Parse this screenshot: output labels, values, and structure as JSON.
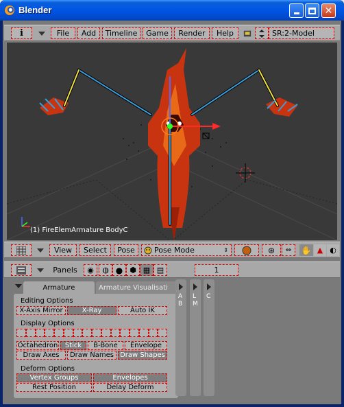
{
  "window": {
    "title": "Blender"
  },
  "top_header": {
    "menus": [
      "File",
      "Add",
      "Timeline",
      "Game",
      "Render",
      "Help"
    ],
    "scene": "SR:2-Model"
  },
  "viewport": {
    "object_label": "(1) FireElemArmature BodyC",
    "colors": {
      "background": "#393939",
      "bone": "#3c9cd6",
      "selected_bone": "#f0e040",
      "body": "#c83410",
      "x_axis": "#ff2a2a",
      "y_axis": "#2aff2a",
      "z_axis": "#4a6cff"
    }
  },
  "view3d_header": {
    "menus": [
      "View",
      "Select",
      "Pose"
    ],
    "mode": "Pose Mode"
  },
  "buttons_header": {
    "panels_label": "Panels",
    "frame": "1"
  },
  "panel": {
    "tabs": [
      "Armature",
      "Armature Visualisati"
    ],
    "editing_label": "Editing Options",
    "editing_buttons": [
      "X-Axis Mirror",
      "X-Ray",
      "Auto IK"
    ],
    "display_label": "Display Options",
    "display_buttons": [
      "Octahedron",
      "Stick",
      "B-Bone",
      "Envelope"
    ],
    "draw_buttons": [
      "Draw Axes",
      "Draw Names",
      "Draw Shapes"
    ],
    "deform_label": "Deform Options",
    "deform_buttons": [
      "Vertex Groups",
      "Envelopes"
    ],
    "position_buttons": [
      "Rest Position",
      "Delay Deform"
    ]
  },
  "side_panels": [
    {
      "letters": "A B"
    },
    {
      "letters": "L M"
    },
    {
      "letters": "C"
    }
  ]
}
